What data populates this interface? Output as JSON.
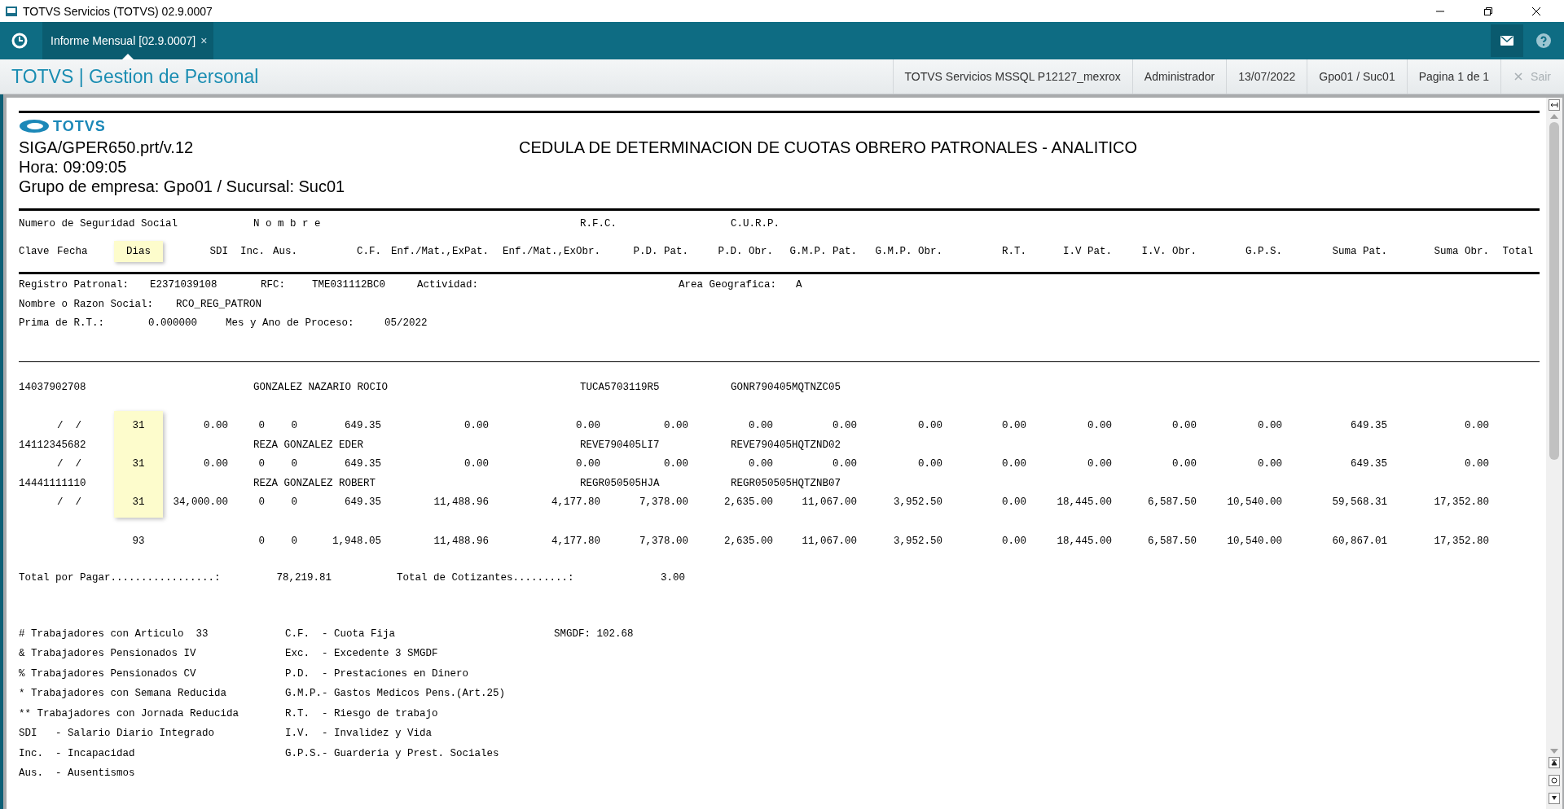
{
  "window": {
    "title": "TOTVS Servicios (TOTVS) 02.9.0007"
  },
  "tabs": [
    {
      "label": "Informe Mensual [02.9.0007]",
      "selected": true,
      "close": "×"
    }
  ],
  "app_header": {
    "title": "TOTVS | Gestion de Personal",
    "info": [
      "TOTVS Servicios MSSQL P12127_mexrox",
      "Administrador",
      "13/07/2022",
      "Gpo01 / Suc01",
      "Pagina 1 de 1"
    ],
    "exit": {
      "label": "Sair",
      "disabled": true
    }
  },
  "report": {
    "logo_text": "TOTVS",
    "program": "SIGA/GPER650.prt/v.12",
    "title": "CEDULA DE DETERMINACION DE CUOTAS OBRERO PATRONALES - ANALITICO",
    "time": "Hora: 09:09:05",
    "group": "Grupo de empresa: Gpo01 / Sucursal: Suc01",
    "header_fields": [
      "Numero de Seguridad Social",
      "N o m b r e",
      "R.F.C.",
      "C.U.R.P."
    ],
    "columns": [
      {
        "label": "Clave",
        "highlighted": false
      },
      {
        "label": "Fecha",
        "highlighted": false
      },
      {
        "label": "Dias",
        "highlighted": true
      },
      {
        "label": "SDI",
        "highlighted": false
      },
      {
        "label": "Inc.",
        "highlighted": false
      },
      {
        "label": "Aus.",
        "highlighted": false
      },
      {
        "label": "C.F.",
        "highlighted": false
      },
      {
        "label": "Enf./Mat.,ExPat.",
        "highlighted": false
      },
      {
        "label": "Enf./Mat.,ExObr.",
        "highlighted": false
      },
      {
        "label": "P.D. Pat.",
        "highlighted": false
      },
      {
        "label": "P.D. Obr.",
        "highlighted": false
      },
      {
        "label": "G.M.P. Pat.",
        "highlighted": false
      },
      {
        "label": "G.M.P. Obr.",
        "highlighted": false
      },
      {
        "label": "R.T.",
        "highlighted": false
      },
      {
        "label": "I.V Pat.",
        "highlighted": false
      },
      {
        "label": "I.V. Obr.",
        "highlighted": false
      },
      {
        "label": "G.P.S.",
        "highlighted": false
      },
      {
        "label": "Suma Pat.",
        "highlighted": false
      },
      {
        "label": "Suma Obr.",
        "highlighted": false
      },
      {
        "label": "Total",
        "highlighted": false
      }
    ],
    "employer": {
      "registro_label": "Registro Patronal:",
      "registro": "E2371039108",
      "rfc_label": "RFC:",
      "rfc": "TME031112BC0",
      "actividad_label": "Actividad:",
      "area_label": "Area Geografica:",
      "area": "A",
      "razon_label": "Nombre o Razon Social:",
      "razon": "RCO_REG_PATRON",
      "prima_label": "Prima de R.T.:",
      "prima": "0.000000",
      "periodo_label": "Mes y Ano de Proceso:",
      "periodo": "05/2022"
    },
    "employees": [
      {
        "nss": "14037902708",
        "name": "GONZALEZ NAZARIO ROCIO",
        "rfc": "TUCA5703119R5",
        "curp": "GONR790405MQTNZC05",
        "fecha": "/  /",
        "dias": "31",
        "sdi": "0.00",
        "amounts": [
          "0",
          "0",
          "649.35",
          "0.00",
          "0.00",
          "0.00",
          "0.00",
          "0.00",
          "0.00",
          "0.00",
          "0.00",
          "0.00",
          "0.00",
          "649.35",
          "0.00"
        ]
      },
      {
        "nss": "14112345682",
        "name": "REZA GONZALEZ EDER",
        "rfc": "REVE790405LI7",
        "curp": "REVE790405HQTZND02",
        "fecha": "/  /",
        "dias": "31",
        "sdi": "0.00",
        "amounts": [
          "0",
          "0",
          "649.35",
          "0.00",
          "0.00",
          "0.00",
          "0.00",
          "0.00",
          "0.00",
          "0.00",
          "0.00",
          "0.00",
          "0.00",
          "649.35",
          "0.00"
        ]
      },
      {
        "nss": "14441111110",
        "name": "REZA GONZALEZ ROBERT",
        "rfc": "REGR050505HJA",
        "curp": "REGR050505HQTZNB07",
        "fecha": "/  /",
        "dias": "31",
        "sdi": "34,000.00",
        "amounts": [
          "0",
          "0",
          "649.35",
          "11,488.96",
          "4,177.80",
          "7,378.00",
          "2,635.00",
          "11,067.00",
          "3,952.50",
          "0.00",
          "18,445.00",
          "6,587.50",
          "10,540.00",
          "59,568.31",
          "17,352.80"
        ]
      }
    ],
    "totals": {
      "dias": "93",
      "amounts": [
        "0",
        "0",
        "1,948.05",
        "11,488.96",
        "4,177.80",
        "7,378.00",
        "2,635.00",
        "11,067.00",
        "3,952.50",
        "0.00",
        "18,445.00",
        "6,587.50",
        "10,540.00",
        "60,867.01",
        "17,352.80"
      ]
    },
    "summary": {
      "pagar_label": "Total por Pagar.................:",
      "pagar": "78,219.81",
      "cotizantes_label": "Total de Cotizantes.........:",
      "cotizantes": "3.00"
    },
    "legend": [
      {
        "left": "# Trabajadores con Articulo  33",
        "middle": "C.F.  - Cuota Fija",
        "right": "SMGDF: 102.68"
      },
      {
        "left": "& Trabajadores Pensionados IV",
        "middle": "Exc.  - Excedente 3 SMGDF"
      },
      {
        "left": "% Trabajadores Pensionados CV",
        "middle": "P.D.  - Prestaciones en Dinero"
      },
      {
        "left": "* Trabajadores con Semana Reducida",
        "middle": "G.M.P.- Gastos Medicos Pens.(Art.25)"
      },
      {
        "left": "** Trabajadores con Jornada Reducida",
        "middle": "R.T.  - Riesgo de trabajo"
      },
      {
        "left": "SDI   - Salario Diario Integrado",
        "middle": "I.V.  - Invalidez y Vida"
      },
      {
        "left": "Inc.  - Incapacidad",
        "middle": "G.P.S.- Guarderia y Prest. Sociales"
      },
      {
        "left": "Aus.  - Ausentismos"
      }
    ]
  }
}
